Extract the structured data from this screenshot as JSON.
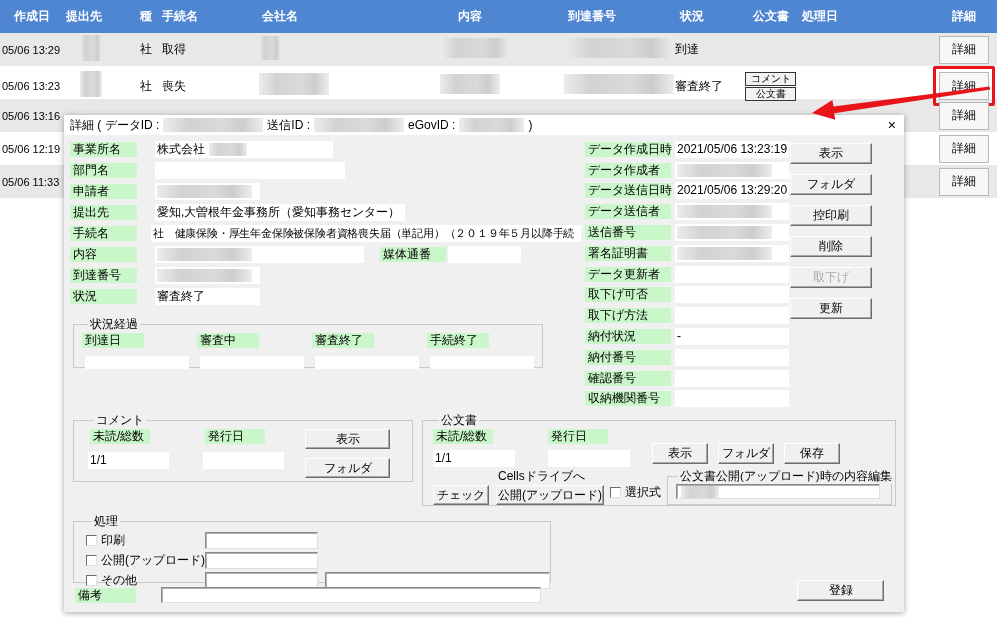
{
  "sheet": {
    "columns": [
      "作成日",
      "提出先",
      "種",
      "手続名",
      "会社名",
      "内容",
      "到達番号",
      "状況",
      "公文書",
      "処理日",
      "詳細"
    ],
    "rows": [
      {
        "created": "05/06 13:29",
        "redacted": true,
        "type": "社",
        "procedure": "取得",
        "status": "到達",
        "detail_button": "詳細",
        "highlighted": false
      },
      {
        "created": "05/06 13:23",
        "redacted": true,
        "type": "社",
        "procedure": "喪失",
        "status": "審査終了",
        "document_buttons": [
          "コメント",
          "公文書"
        ],
        "detail_button": "詳細",
        "highlighted": true
      },
      {
        "created": "05/06 13:16",
        "detail_button": "詳細",
        "highlighted": false
      },
      {
        "created": "05/06 12:19",
        "detail_button": "詳細",
        "highlighted": false
      },
      {
        "created": "05/06 11:33",
        "detail_button": "詳細",
        "highlighted": false
      }
    ]
  },
  "dialog": {
    "title_segments": [
      "詳細 ( データID :",
      "送信ID :",
      "eGovID :",
      ")"
    ],
    "close": "×",
    "fields": [
      {
        "label": "事業所名",
        "value": "株式会社",
        "blurred": true
      },
      {
        "label": "部門名"
      },
      {
        "label": "申請者",
        "blurred": true
      },
      {
        "label": "提出先",
        "value": "愛知,大曽根年金事務所（愛知事務センター）"
      },
      {
        "label": "手続名",
        "value": "社　健康保険・厚生年金保険被保険者資格喪失届（単記用）（２０１９年５月以降手続"
      },
      {
        "label": "内容",
        "blurred": true,
        "extra": {
          "label": "媒体通番"
        }
      },
      {
        "label": "到達番号",
        "blurred": true
      },
      {
        "label": "状況",
        "value": "審査終了"
      }
    ],
    "progress": {
      "title": "状況経過",
      "steps": [
        "到達日",
        "審査中",
        "審査終了",
        "手続終了"
      ]
    },
    "meta_fields": [
      {
        "label": "データ作成日時",
        "value": "2021/05/06 13:23:19"
      },
      {
        "label": "データ作成者",
        "blurred": true
      },
      {
        "label": "データ送信日時",
        "value": "2021/05/06 13:29:20"
      },
      {
        "label": "データ送信者",
        "blurred": true
      },
      {
        "label": "送信番号",
        "blurred": true
      },
      {
        "label": "署名証明書",
        "blurred": true
      },
      {
        "label": "データ更新者"
      },
      {
        "label": "取下げ可否"
      },
      {
        "label": "取下げ方法"
      },
      {
        "label": "納付状況",
        "value": "-"
      },
      {
        "label": "納付番号"
      },
      {
        "label": "確認番号"
      },
      {
        "label": "収納機関番号"
      }
    ],
    "actions": [
      {
        "label": "表示",
        "disabled": false
      },
      {
        "label": "フォルダ",
        "disabled": false
      },
      {
        "label": "控印刷",
        "disabled": false
      },
      {
        "label": "削除",
        "disabled": false
      },
      {
        "label": "取下げ",
        "disabled": true
      },
      {
        "label": "更新",
        "disabled": false
      }
    ],
    "comment": {
      "title": "コメント",
      "unread_label": "未読/総数",
      "unread": "1/1",
      "issued_label": "発行日",
      "buttons": [
        "表示",
        "フォルダ"
      ]
    },
    "official": {
      "title": "公文書",
      "unread_label": "未読/総数",
      "unread": "1/1",
      "issued_label": "発行日",
      "buttons": [
        "表示",
        "フォルダ",
        "保存"
      ],
      "cells_label": "Cellsドライブへ",
      "cells_buttons": [
        "チェック",
        "公開(アップロード)"
      ],
      "select": {
        "label": "選択式",
        "checked": false
      },
      "edit": {
        "title": "公文書公開(アップロード)時の内容編集",
        "blurred": true
      }
    },
    "processing": {
      "title": "処理",
      "items": [
        {
          "label": "印刷",
          "checked": false
        },
        {
          "label": "公開(アップロード)",
          "checked": false
        },
        {
          "label": "その他",
          "checked": false
        }
      ]
    },
    "remarks": {
      "label": "備考"
    },
    "register": "登録"
  }
}
